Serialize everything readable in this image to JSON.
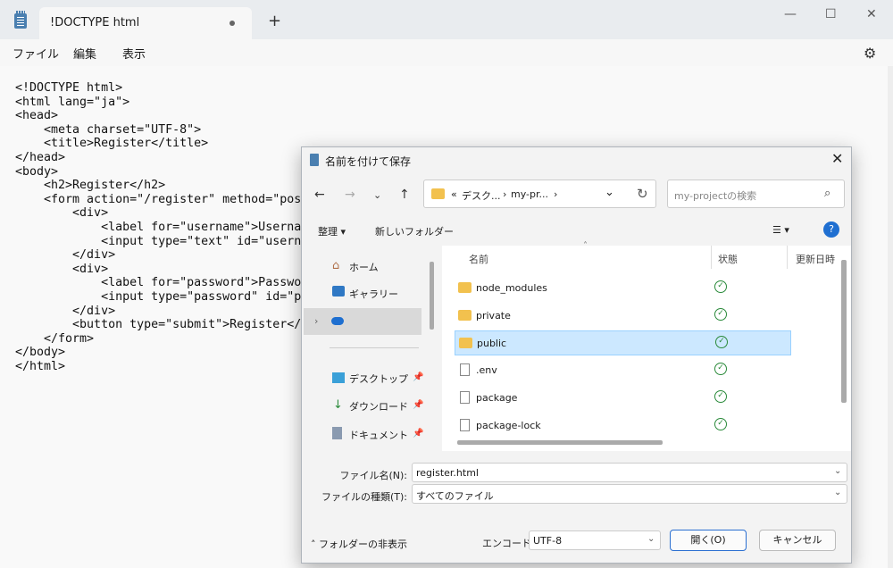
{
  "window": {
    "tab_title": "!DOCTYPE html",
    "new_tab_icon": "+",
    "controls": {
      "minimize": "—",
      "maximize": "☐",
      "close": "✕"
    }
  },
  "menu": {
    "file": "ファイル",
    "edit": "編集",
    "view": "表示"
  },
  "editor": {
    "code": "<!DOCTYPE html>\n<html lang=\"ja\">\n<head>\n    <meta charset=\"UTF-8\">\n    <title>Register</title>\n</head>\n<body>\n    <h2>Register</h2>\n    <form action=\"/register\" method=\"post\n        <div>\n            <label for=\"username\">Usernam\n            <input type=\"text\" id=\"userna\n        </div>\n        <div>\n            <label for=\"password\">Passwor\n            <input type=\"password\" id=\"pa\n        </div>\n        <button type=\"submit\">Register</b\n    </form>\n</body>\n</html>"
  },
  "dialog": {
    "title": "名前を付けて保存",
    "address": {
      "chev": "«",
      "seg1": "デスク...",
      "sep": "›",
      "seg2": "my-pr...",
      "sep2": "›"
    },
    "search_placeholder": "my-projectの検索",
    "toolbar": {
      "organize": "整理 ▾",
      "new_folder": "新しいフォルダー",
      "view": "☰ ▾",
      "help": "?"
    },
    "sidebar": {
      "home": "ホーム",
      "gallery": "ギャラリー",
      "desktop": "デスクトップ",
      "downloads": "ダウンロード",
      "documents": "ドキュメント"
    },
    "columns": {
      "name": "名前",
      "status": "状態",
      "modified": "更新日時"
    },
    "files": [
      {
        "name": "node_modules",
        "type": "folder"
      },
      {
        "name": "private",
        "type": "folder"
      },
      {
        "name": "public",
        "type": "folder"
      },
      {
        "name": ".env",
        "type": "file"
      },
      {
        "name": "package",
        "type": "file"
      },
      {
        "name": "package-lock",
        "type": "file"
      }
    ],
    "filename_label": "ファイル名(N):",
    "filename_value": "register.html",
    "filetype_label": "ファイルの種類(T):",
    "filetype_value": "すべてのファイル",
    "hide_folders": "フォルダーの非表示",
    "encoding_label": "エンコード:",
    "encoding_value": "UTF-8",
    "open_button": "開く(O)",
    "cancel_button": "キャンセル"
  }
}
